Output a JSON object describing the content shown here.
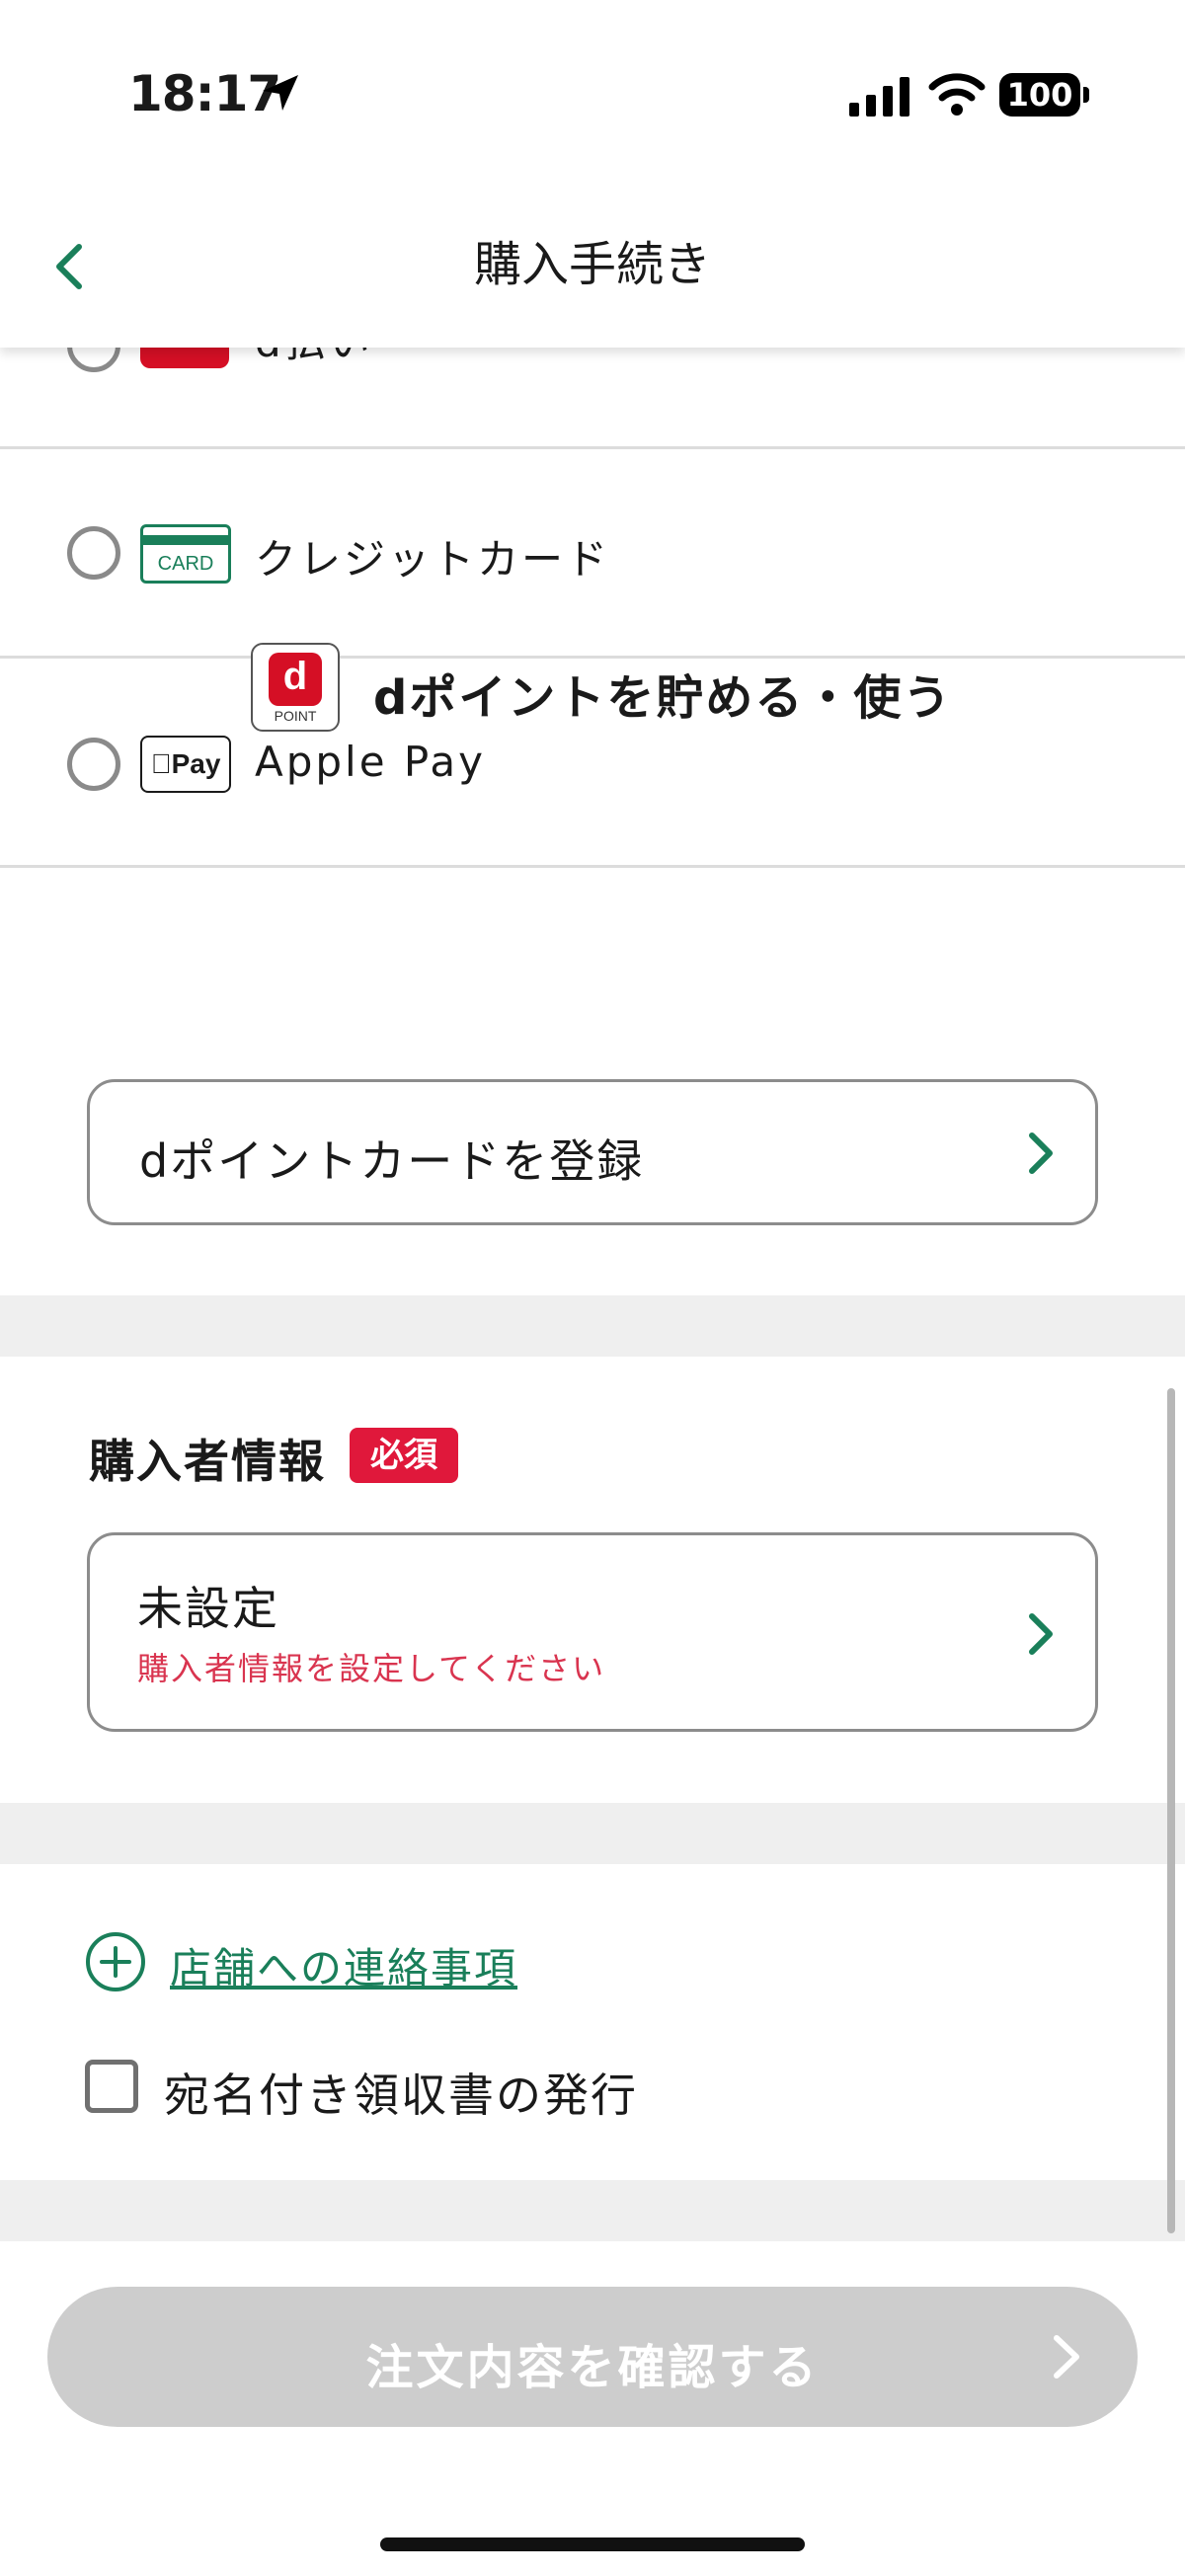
{
  "status_bar": {
    "time": "18:17",
    "battery": "100",
    "location_icon": "location-arrow-icon",
    "signal_icon": "cellular-signal-icon",
    "wifi_icon": "wifi-icon"
  },
  "header": {
    "title": "購入手続き",
    "back_icon": "chevron-left-icon"
  },
  "payment_methods": [
    {
      "label": "d払い",
      "logo": "d-barai-logo",
      "selected": false
    },
    {
      "label": "クレジットカード",
      "logo": "credit-card-logo",
      "logo_text": "CARD",
      "selected": false
    },
    {
      "label": "Apple Pay",
      "logo": "apple-pay-logo",
      "logo_text": "Pay",
      "selected": false
    }
  ],
  "dpoint": {
    "logo_letter": "d",
    "logo_text": "POINT",
    "title": "dポイントを貯める・使う",
    "register_label": "dポイントカードを登録"
  },
  "buyer": {
    "title": "購入者情報",
    "required_badge": "必須",
    "value": "未設定",
    "message": "購入者情報を設定してください"
  },
  "extras": {
    "contact_link": "店舗への連絡事項",
    "receipt_label": "宛名付き領収書の発行",
    "receipt_checked": false
  },
  "footer": {
    "confirm_label": "注文内容を確認する",
    "confirm_enabled": false
  },
  "colors": {
    "accent_green": "#1a7f5a",
    "required_red": "#e0183b",
    "error_text": "#d9344f",
    "disabled_button": "#cdcdcd"
  }
}
